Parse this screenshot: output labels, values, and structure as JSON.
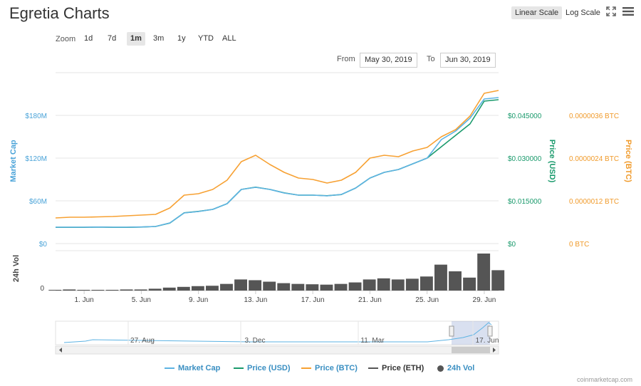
{
  "header": {
    "title": "Egretia Charts",
    "linear_scale": "Linear Scale",
    "log_scale": "Log Scale"
  },
  "zoom": {
    "label": "Zoom",
    "buttons": [
      "1d",
      "7d",
      "1m",
      "3m",
      "1y",
      "YTD",
      "ALL"
    ],
    "selected": "1m"
  },
  "range": {
    "from_label": "From",
    "from": "May 30, 2019",
    "to_label": "To",
    "to": "Jun 30, 2019"
  },
  "credit": "coinmarketcap.com",
  "colors": {
    "market_cap": "#5db3e3",
    "price_usd": "#1a9a6c",
    "price_btc": "#f7a133",
    "price_eth": "#555555",
    "volume": "#555555"
  },
  "chart_data": {
    "type": "line",
    "x_ticks": [
      "1. Jun",
      "5. Jun",
      "9. Jun",
      "13. Jun",
      "17. Jun",
      "21. Jun",
      "25. Jun",
      "29. Jun"
    ],
    "axis_left": {
      "label": "Market Cap",
      "ticks": [
        "$0",
        "$60M",
        "$120M",
        "$180M"
      ],
      "ylim": [
        0,
        240
      ]
    },
    "axis_usd": {
      "label": "Price (USD)",
      "ticks": [
        "$0",
        "$0.015000",
        "$0.030000",
        "$0.045000"
      ],
      "ylim": [
        0,
        0.06
      ]
    },
    "axis_btc": {
      "label": "Price (BTC)",
      "ticks": [
        "0 BTC",
        "0.0000012 BTC",
        "0.0000024 BTC",
        "0.0000036 BTC"
      ],
      "ylim": [
        0,
        4.8e-06
      ]
    },
    "volume_axis": {
      "label": "24h Vol",
      "ticks": [
        "0"
      ]
    },
    "navigator_labels": [
      "27. Aug",
      "3. Dec",
      "11. Mar",
      "17. Jun"
    ],
    "days": [
      0,
      1,
      2,
      3,
      4,
      5,
      6,
      7,
      8,
      9,
      10,
      11,
      12,
      13,
      14,
      15,
      16,
      17,
      18,
      19,
      20,
      21,
      22,
      23,
      24,
      25,
      26,
      27,
      28,
      29,
      30,
      31
    ],
    "series": [
      {
        "name": "Price (USD)",
        "axis": "usd",
        "values": [
          0.0057,
          0.0057,
          0.0057,
          0.0058,
          0.0057,
          0.0057,
          0.0058,
          0.006,
          0.0072,
          0.0108,
          0.0113,
          0.012,
          0.014,
          0.019,
          0.0198,
          0.019,
          0.0178,
          0.017,
          0.017,
          0.0168,
          0.0172,
          0.0195,
          0.023,
          0.025,
          0.026,
          0.028,
          0.03,
          0.034,
          0.038,
          0.042,
          0.05,
          0.0505
        ]
      },
      {
        "name": "Market Cap",
        "axis": "left",
        "values": [
          23,
          23,
          23,
          23.2,
          23,
          23,
          23.3,
          24,
          29,
          43,
          45,
          48,
          56,
          76,
          79,
          76,
          71,
          68,
          68,
          67,
          69,
          78,
          92,
          100,
          104,
          112,
          120,
          146,
          158,
          176,
          203,
          205
        ]
      },
      {
        "name": "Price (BTC)",
        "axis": "btc",
        "values": [
          7.2e-07,
          7.4e-07,
          7.4e-07,
          7.5e-07,
          7.6e-07,
          7.8e-07,
          8e-07,
          8.2e-07,
          1e-06,
          1.36e-06,
          1.4e-06,
          1.52e-06,
          1.78e-06,
          2.3e-06,
          2.48e-06,
          2.22e-06,
          2e-06,
          1.84e-06,
          1.8e-06,
          1.7e-06,
          1.78e-06,
          2e-06,
          2.4e-06,
          2.48e-06,
          2.44e-06,
          2.6e-06,
          2.7e-06,
          3e-06,
          3.2e-06,
          3.58e-06,
          4.22e-06,
          4.3e-06
        ]
      }
    ],
    "volume_values": [
      0.02,
      0.03,
      0.02,
      0.02,
      0.02,
      0.03,
      0.03,
      0.05,
      0.08,
      0.1,
      0.12,
      0.13,
      0.18,
      0.3,
      0.28,
      0.24,
      0.2,
      0.18,
      0.17,
      0.16,
      0.18,
      0.22,
      0.3,
      0.33,
      0.3,
      0.32,
      0.38,
      0.7,
      0.52,
      0.35,
      1.0,
      0.55
    ],
    "legend": [
      "Market Cap",
      "Price (USD)",
      "Price (BTC)",
      "Price (ETH)",
      "24h Vol"
    ]
  }
}
